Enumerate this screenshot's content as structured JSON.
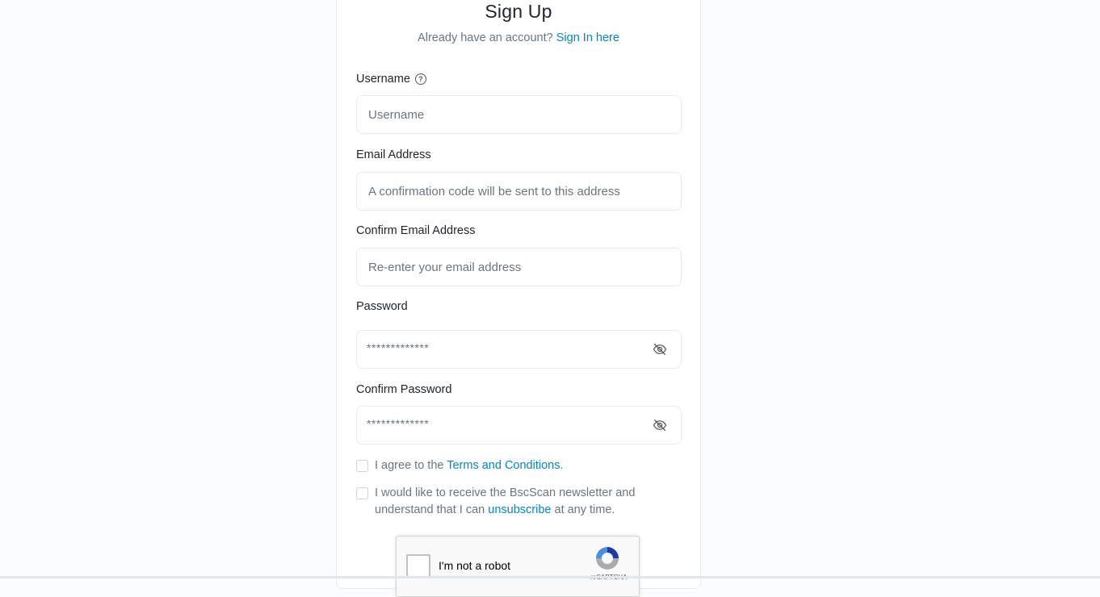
{
  "form": {
    "title": "Sign Up",
    "subtitle_prefix": "Already have an account?",
    "signin_link": "Sign In here",
    "fields": {
      "username": {
        "label": "Username",
        "placeholder": "Username",
        "help_icon": "question-circle-icon"
      },
      "email": {
        "label": "Email Address",
        "placeholder": "A confirmation code will be sent to this address"
      },
      "confirm_email": {
        "label": "Confirm Email Address",
        "placeholder": "Re-enter your email address"
      },
      "password": {
        "label": "Password",
        "placeholder": "*************",
        "toggle_icon": "eye-slash-icon"
      },
      "confirm_password": {
        "label": "Confirm Password",
        "placeholder": "*************",
        "toggle_icon": "eye-slash-icon"
      }
    },
    "terms": {
      "prefix": "I agree to the",
      "link": "Terms and Conditions",
      "suffix": ".",
      "checked": false
    },
    "newsletter": {
      "line1": "I would like to receive the BscScan newsletter and",
      "line2_prefix": "understand that I can",
      "link": "unsubscribe",
      "line2_suffix": "at any time.",
      "checked": false
    },
    "captcha": {
      "label": "I'm not a robot",
      "brand": "reCAPTCHA"
    }
  },
  "colors": {
    "link": "#0784c3",
    "muted_text": "#6c757d",
    "background": "#fbfcfd"
  }
}
